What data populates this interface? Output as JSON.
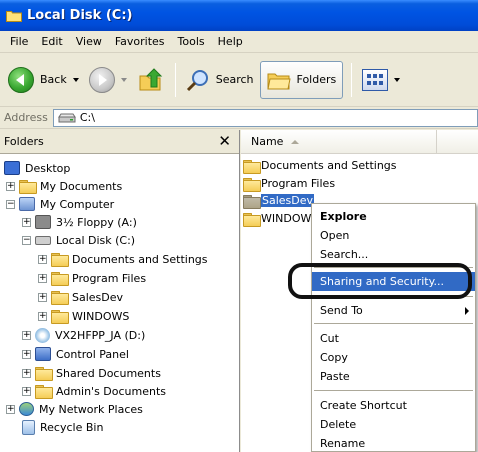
{
  "window": {
    "title": "Local Disk (C:)"
  },
  "menubar": {
    "items": [
      "File",
      "Edit",
      "View",
      "Favorites",
      "Tools",
      "Help"
    ]
  },
  "toolbar": {
    "back_label": "Back",
    "search_label": "Search",
    "folders_label": "Folders"
  },
  "addressbar": {
    "label": "Address",
    "value": "C:\\"
  },
  "folders_pane": {
    "title": "Folders",
    "items": [
      {
        "label": "Desktop",
        "icon": "desktop-icon",
        "expander": ""
      },
      {
        "label": "My Documents",
        "icon": "my-documents-icon",
        "expander": "+"
      },
      {
        "label": "My Computer",
        "icon": "my-computer-icon",
        "expander": "−"
      },
      {
        "label": "3½ Floppy (A:)",
        "icon": "floppy-icon",
        "expander": "+"
      },
      {
        "label": "Local Disk (C:)",
        "icon": "hard-disk-icon",
        "expander": "−"
      },
      {
        "label": "Documents and Settings",
        "icon": "folder-icon",
        "expander": "+"
      },
      {
        "label": "Program Files",
        "icon": "folder-icon",
        "expander": "+"
      },
      {
        "label": "SalesDev",
        "icon": "folder-icon",
        "expander": "+"
      },
      {
        "label": "WINDOWS",
        "icon": "folder-icon",
        "expander": "+"
      },
      {
        "label": "VX2HFPP_JA (D:)",
        "icon": "cd-drive-icon",
        "expander": "+"
      },
      {
        "label": "Control Panel",
        "icon": "control-panel-icon",
        "expander": "+"
      },
      {
        "label": "Shared Documents",
        "icon": "folder-icon",
        "expander": "+"
      },
      {
        "label": "Admin's Documents",
        "icon": "folder-icon",
        "expander": "+"
      },
      {
        "label": "My Network Places",
        "icon": "network-places-icon",
        "expander": "+"
      },
      {
        "label": "Recycle Bin",
        "icon": "recycle-bin-icon",
        "expander": ""
      }
    ]
  },
  "list_pane": {
    "column_name": "Name",
    "items": [
      {
        "label": "Documents and Settings",
        "selected": false
      },
      {
        "label": "Program Files",
        "selected": false
      },
      {
        "label": "SalesDev",
        "selected": true
      },
      {
        "label": "WINDOWS",
        "selected": false
      }
    ]
  },
  "context_menu": {
    "items": [
      "Explore",
      "Open",
      "Search...",
      "Sharing and Security...",
      "Send To",
      "Cut",
      "Copy",
      "Paste",
      "Create Shortcut",
      "Delete",
      "Rename"
    ],
    "highlighted": "Sharing and Security..."
  },
  "colors": {
    "title_bar": "#0054e3",
    "selection": "#316ac5",
    "chrome": "#ece9d8"
  }
}
